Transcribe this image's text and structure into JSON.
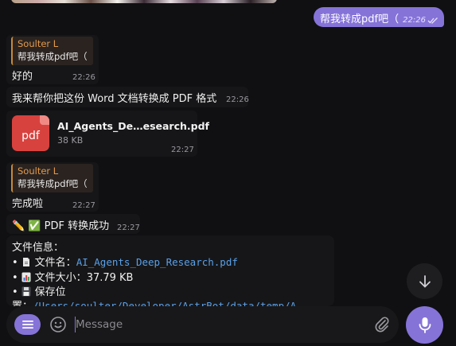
{
  "outgoing": {
    "text": "帮我转成pdf吧（",
    "time": "22:26"
  },
  "messages": [
    {
      "reply_name": "Soulter L",
      "reply_text": "帮我转成pdf吧（",
      "text": "好的",
      "time": "22:26"
    },
    {
      "text": "我来帮你把这份 Word 文档转换成 PDF 格式",
      "time": "22:26"
    },
    {
      "file_name": "AI_Agents_De…esearch.pdf",
      "file_size": "38 KB",
      "file_icon_text": "pdf",
      "time": "22:27"
    },
    {
      "reply_name": "Soulter L",
      "reply_text": "帮我转成pdf吧（",
      "text": "完成啦",
      "time": "22:27"
    },
    {
      "text": "✏️ ✅ PDF 转换成功",
      "time": "22:27"
    }
  ],
  "file_info": {
    "heading": "文件信息：",
    "name_label": "文件名：",
    "name_value": "AI_Agents_Deep_Research.pdf",
    "size_label": "文件大小：",
    "size_value": "37.79 KB",
    "location_label": "保存位",
    "location_cont": "置：",
    "location_value": "/Users/soulter/Developer/AstrBot/data/temp/A"
  },
  "composer": {
    "placeholder": "Message"
  },
  "colors": {
    "accent": "#8673d8",
    "background": "#101012",
    "reply_bar": "#c58a3a",
    "link": "#5aa0e8"
  },
  "icons": [
    "double-check-icon",
    "pdf-file-icon",
    "document-icon",
    "bar-chart-icon",
    "floppy-disk-icon",
    "arrow-down-icon",
    "menu-icon",
    "emoji-icon",
    "paperclip-icon",
    "microphone-icon"
  ]
}
